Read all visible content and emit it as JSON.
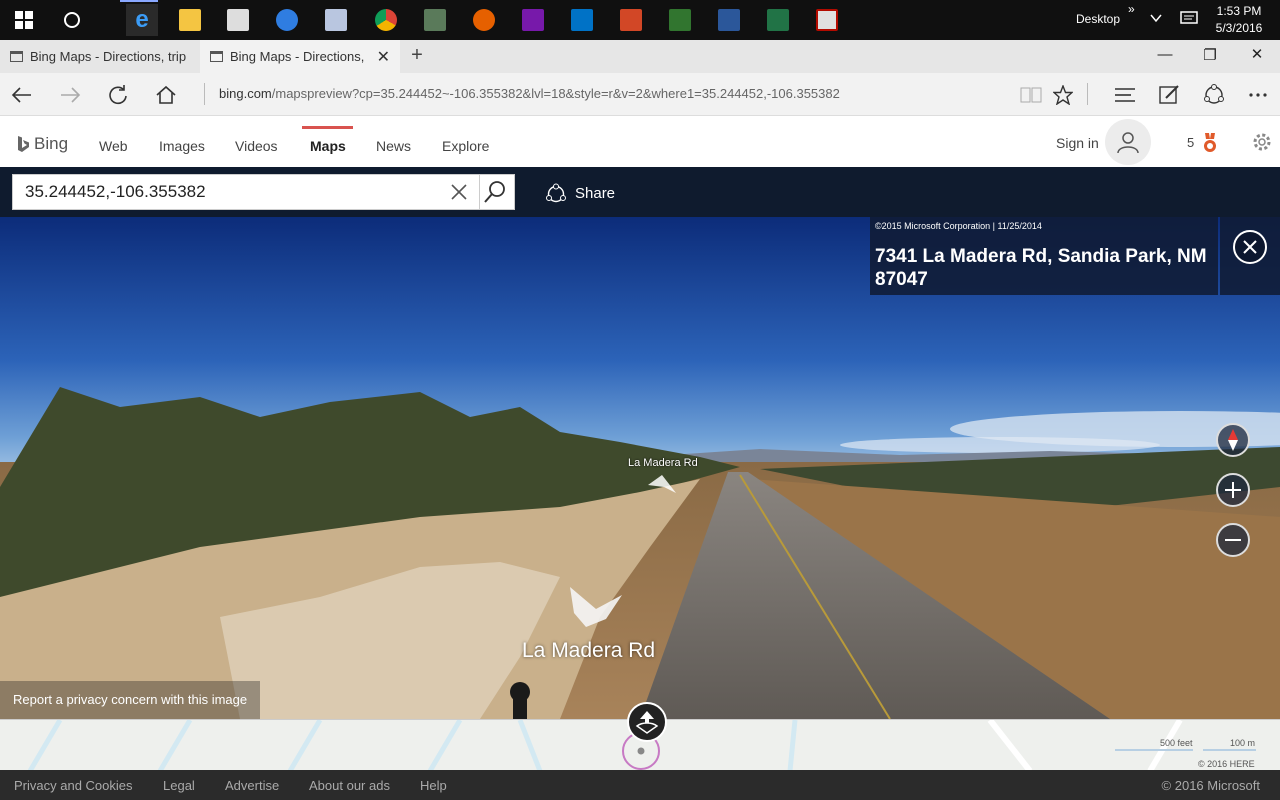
{
  "taskbar": {
    "desktop_label": "Desktop",
    "overflow": "»",
    "time": "1:53 PM",
    "date": "5/3/2016",
    "apps": [
      "windows-start-icon",
      "cortana-icon",
      "edge-icon",
      "file-explorer-icon",
      "store-icon",
      "malwarebytes-icon",
      "app-icon",
      "chrome-icon",
      "app-icon",
      "firefox-icon",
      "onenote-icon",
      "outlook-icon",
      "powerpoint-icon",
      "project-icon",
      "word-icon",
      "excel-icon",
      "acrobat-icon"
    ]
  },
  "tabs": [
    {
      "label": "Bing Maps - Directions, trip"
    },
    {
      "label": "Bing Maps - Directions,"
    }
  ],
  "address_bar": {
    "url_domain": "bing.com",
    "url_rest": "/mapspreview?cp=35.244452~-106.355382&lvl=18&style=r&v=2&where1=35.244452,-106.355382"
  },
  "bing": {
    "logo": "Bing",
    "nav": [
      {
        "label": "Web"
      },
      {
        "label": "Images"
      },
      {
        "label": "Videos"
      },
      {
        "label": "Maps"
      },
      {
        "label": "News"
      },
      {
        "label": "Explore"
      }
    ],
    "sign_in": "Sign in",
    "rewards_count": "5",
    "accent": "#d9534f"
  },
  "search": {
    "value": "35.244452,-106.355382",
    "share_label": "Share"
  },
  "streetside": {
    "copyright": "©2015 Microsoft Corporation | 11/25/2014",
    "address": "7341 La Madera Rd, Sandia Park, NM 87047",
    "road_label_small": "La Madera Rd",
    "road_label_big": "La Madera Rd",
    "privacy": "Report a privacy concern with this image"
  },
  "minimap": {
    "scale_feet": "500 feet",
    "scale_m": "100 m",
    "copyright": "© 2016 HERE"
  },
  "footer": {
    "links": [
      {
        "label": "Privacy and Cookies"
      },
      {
        "label": "Legal"
      },
      {
        "label": "Advertise"
      },
      {
        "label": "About our ads"
      },
      {
        "label": "Help"
      }
    ],
    "copyright": "© 2016 Microsoft"
  }
}
